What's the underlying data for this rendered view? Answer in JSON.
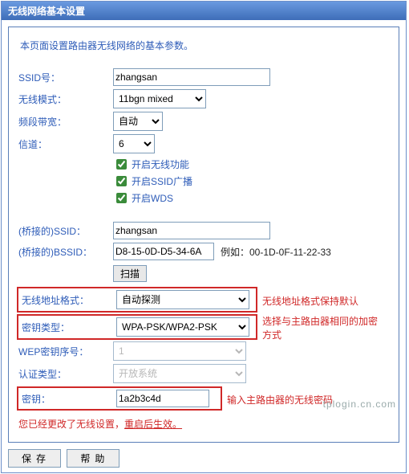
{
  "header": {
    "title": "无线网络基本设置"
  },
  "intro": "本页面设置路由器无线网络的基本参数。",
  "fields": {
    "ssid_label": "SSID号：",
    "ssid_value": "zhangsan",
    "mode_label": "无线模式：",
    "mode_value": "11bgn mixed",
    "bw_label": "频段带宽：",
    "bw_value": "自动",
    "ch_label": "信道：",
    "ch_value": "6",
    "cb_radio": "开启无线功能",
    "cb_ssid": "开启SSID广播",
    "cb_wds": "开启WDS",
    "bssid_label": "(桥接的)SSID：",
    "bssid_value": "zhangsan",
    "bmac_label": "(桥接的)BSSID：",
    "bmac_value": "D8-15-0D-D5-34-6A",
    "bmac_example": "例如：00-1D-0F-11-22-33",
    "scan": "扫描",
    "addrfmt_label": "无线地址格式：",
    "addrfmt_value": "自动探测",
    "addrfmt_note": "无线地址格式保持默认",
    "keytype_label": "密钥类型：",
    "keytype_value": "WPA-PSK/WPA2-PSK",
    "keytype_note": "选择与主路由器相同的加密方式",
    "wepidx_label": "WEP密钥序号：",
    "wepidx_value": "1",
    "auth_label": "认证类型：",
    "auth_value": "开放系统",
    "key_label": "密钥：",
    "key_value": "1a2b3c4d",
    "key_note": "输入主路由器的无线密码",
    "final_a": "您已经更改了无线设置，",
    "final_b": "重启后生效。"
  },
  "buttons": {
    "save": "保存",
    "help": "帮助"
  },
  "watermark": "tplogin.cn.com"
}
